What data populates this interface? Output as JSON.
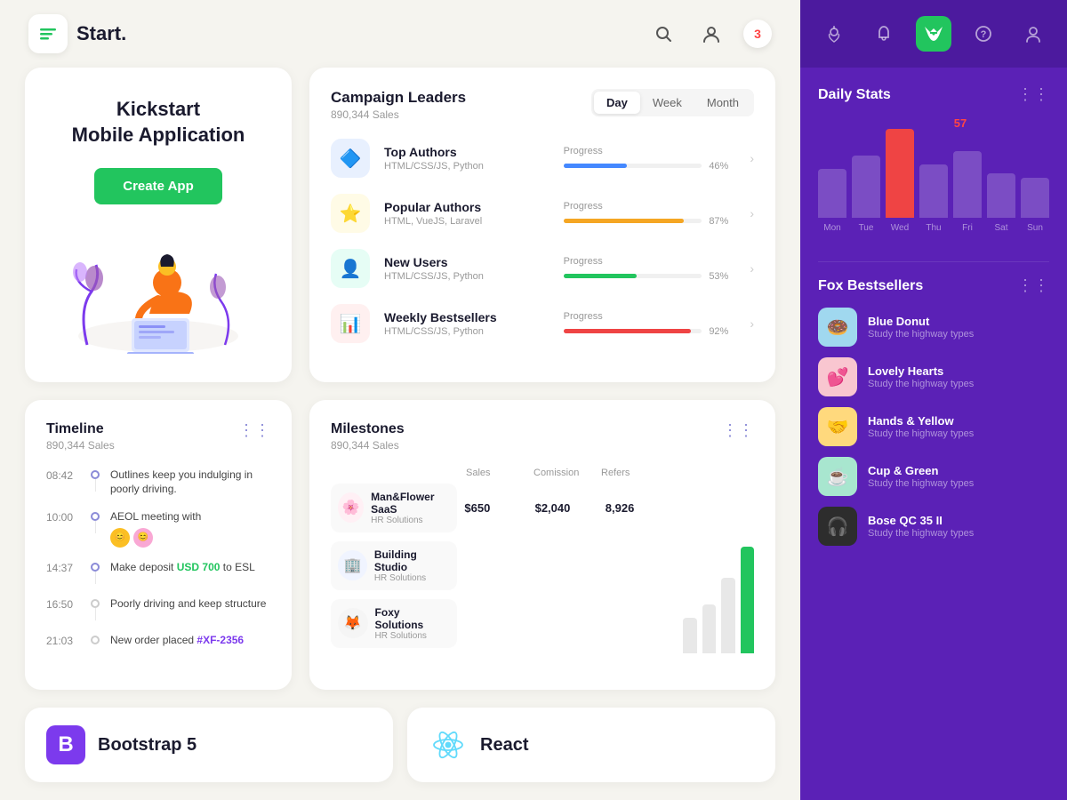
{
  "header": {
    "logo_text": "Start.",
    "notification_count": "3"
  },
  "kickstart": {
    "title_line1": "Kickstart",
    "title_line2": "Mobile Application",
    "button_label": "Create App"
  },
  "campaign": {
    "title": "Campaign Leaders",
    "subtitle": "890,344 Sales",
    "tabs": [
      "Day",
      "Week",
      "Month"
    ],
    "active_tab": "Day",
    "rows": [
      {
        "name": "Top Authors",
        "sub": "HTML/CSS/JS, Python",
        "color": "#e8f0fe",
        "icon": "🔷",
        "progress": 46,
        "bar_color": "#4488ff"
      },
      {
        "name": "Popular Authors",
        "sub": "HTML, VueJS, Laravel",
        "color": "#fffbe6",
        "icon": "⭐",
        "progress": 87,
        "bar_color": "#f5a623"
      },
      {
        "name": "New Users",
        "sub": "HTML/CSS/JS, Python",
        "color": "#e6fdf5",
        "icon": "👤",
        "progress": 53,
        "bar_color": "#22c55e"
      },
      {
        "name": "Weekly Bestsellers",
        "sub": "HTML/CSS/JS, Python",
        "color": "#fff0f0",
        "icon": "📊",
        "progress": 92,
        "bar_color": "#ef4444"
      }
    ]
  },
  "timeline": {
    "title": "Timeline",
    "subtitle": "890,344 Sales",
    "items": [
      {
        "time": "08:42",
        "text": "Outlines keep you indulging in poorly driving.",
        "has_avatars": false,
        "highlight": null
      },
      {
        "time": "10:00",
        "text": "AEOL meeting with",
        "has_avatars": true,
        "highlight": null
      },
      {
        "time": "14:37",
        "text": "Make deposit ",
        "highlight_text": "USD 700",
        "highlight_color": "green",
        "suffix": " to ESL",
        "has_avatars": false
      },
      {
        "time": "16:50",
        "text": "Poorly driving and keep structure",
        "has_avatars": false,
        "highlight": null
      },
      {
        "time": "21:03",
        "text": "New order placed ",
        "highlight_text": "#XF-2356",
        "highlight_color": "purple",
        "has_avatars": false
      }
    ]
  },
  "milestones": {
    "title": "Milestones",
    "subtitle": "890,344 Sales",
    "column_labels": [
      "",
      "Sales",
      "Comission",
      "Refers"
    ],
    "rows": [
      {
        "name": "Man&Flower SaaS",
        "sub": "HR Solutions",
        "icon": "🌸",
        "bg": "#fff0f5",
        "sales": "$650",
        "commission": "$2,040",
        "refers": "8,926"
      },
      {
        "name": "Building Studio",
        "sub": "HR Solutions",
        "icon": "🏢",
        "bg": "#f0f4ff",
        "sales": "",
        "commission": "",
        "refers": ""
      },
      {
        "name": "Foxy Solutions",
        "sub": "HR Solutions",
        "icon": "🦊",
        "bg": "#f5f5f5",
        "sales": "",
        "commission": "",
        "refers": ""
      }
    ],
    "chart_bars": [
      {
        "height": 40,
        "color": "#e8e8e8"
      },
      {
        "height": 55,
        "color": "#e8e8e8"
      },
      {
        "height": 85,
        "color": "#e8e8e8"
      },
      {
        "height": 120,
        "color": "#22c55e"
      }
    ]
  },
  "brands": [
    {
      "name": "Bootstrap 5",
      "logo": "B",
      "bg": "#7c3aed",
      "text_color": "#fff"
    },
    {
      "name": "React",
      "icon": "⚛",
      "bg": "#61dafb33"
    }
  ],
  "sidebar": {
    "icons": [
      "📍",
      "🔔",
      "🦊",
      "❓",
      "👤"
    ],
    "active_icon_index": 2,
    "daily_stats": {
      "title": "Daily Stats",
      "peak_value": "57",
      "bars": [
        {
          "day": "Mon",
          "height": 55,
          "color": "rgba(255,255,255,0.2)"
        },
        {
          "day": "Tue",
          "height": 70,
          "color": "rgba(255,255,255,0.2)"
        },
        {
          "day": "Wed",
          "height": 100,
          "color": "#ef4444"
        },
        {
          "day": "Thu",
          "height": 60,
          "color": "rgba(255,255,255,0.2)"
        },
        {
          "day": "Fri",
          "height": 75,
          "color": "rgba(255,255,255,0.2)"
        },
        {
          "day": "Sat",
          "height": 50,
          "color": "rgba(255,255,255,0.2)"
        },
        {
          "day": "Sun",
          "height": 45,
          "color": "rgba(255,255,255,0.2)"
        }
      ]
    },
    "fox_bestsellers": {
      "title": "Fox Bestsellers",
      "items": [
        {
          "name": "Blue Donut",
          "sub": "Study the highway types",
          "bg": "#a0d8ef",
          "icon": "🍩"
        },
        {
          "name": "Lovely Hearts",
          "sub": "Study the highway types",
          "bg": "#f9c6d0",
          "icon": "💕"
        },
        {
          "name": "Hands & Yellow",
          "sub": "Study the highway types",
          "bg": "#ffd97d",
          "icon": "🤝"
        },
        {
          "name": "Cup & Green",
          "sub": "Study the highway types",
          "bg": "#a8e6cf",
          "icon": "☕"
        },
        {
          "name": "Bose QC 35 II",
          "sub": "Study the highway types",
          "bg": "#2d2d2d",
          "icon": "🎧"
        }
      ]
    }
  }
}
